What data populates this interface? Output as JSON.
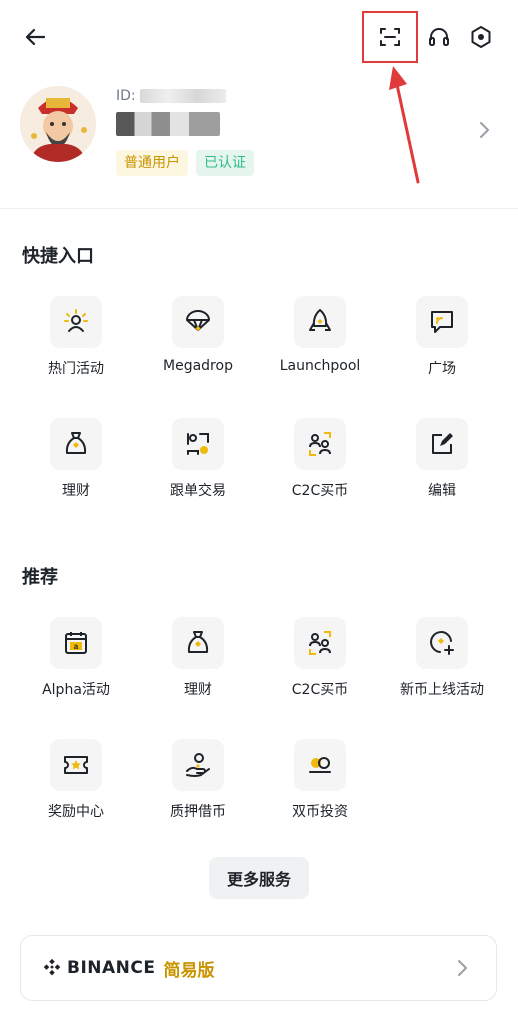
{
  "header": {
    "back_icon": "arrow-left-icon",
    "scan_icon": "scan-icon",
    "support_icon": "headset-icon",
    "settings_icon": "settings-hexagon-icon",
    "highlight_color": "#e03a3a"
  },
  "profile": {
    "id_label": "ID:",
    "badge_user": "普通用户",
    "badge_verified": "已认证"
  },
  "quick_access": {
    "title": "快捷入口",
    "items": [
      {
        "label": "热门活动",
        "icon": "campaign-person-icon"
      },
      {
        "label": "Megadrop",
        "icon": "parachute-icon"
      },
      {
        "label": "Launchpool",
        "icon": "rocket-icon"
      },
      {
        "label": "广场",
        "icon": "square-feed-icon"
      },
      {
        "label": "理财",
        "icon": "money-bag-icon"
      },
      {
        "label": "跟单交易",
        "icon": "copy-trade-icon"
      },
      {
        "label": "C2C买币",
        "icon": "c2c-users-icon"
      },
      {
        "label": "编辑",
        "icon": "edit-icon"
      }
    ]
  },
  "recommended": {
    "title": "推荐",
    "items": [
      {
        "label": "Alpha活动",
        "icon": "calendar-alpha-icon"
      },
      {
        "label": "理财",
        "icon": "money-bag-icon"
      },
      {
        "label": "C2C买币",
        "icon": "c2c-users-icon"
      },
      {
        "label": "新币上线活动",
        "icon": "new-listing-icon"
      },
      {
        "label": "奖励中心",
        "icon": "reward-ticket-icon"
      },
      {
        "label": "质押借币",
        "icon": "loan-hand-icon"
      },
      {
        "label": "双币投资",
        "icon": "dual-coin-icon"
      }
    ]
  },
  "more_button": "更多服务",
  "lite_card": {
    "brand": "BINANCE",
    "label": "简易版",
    "brand_color": "#c99400"
  }
}
